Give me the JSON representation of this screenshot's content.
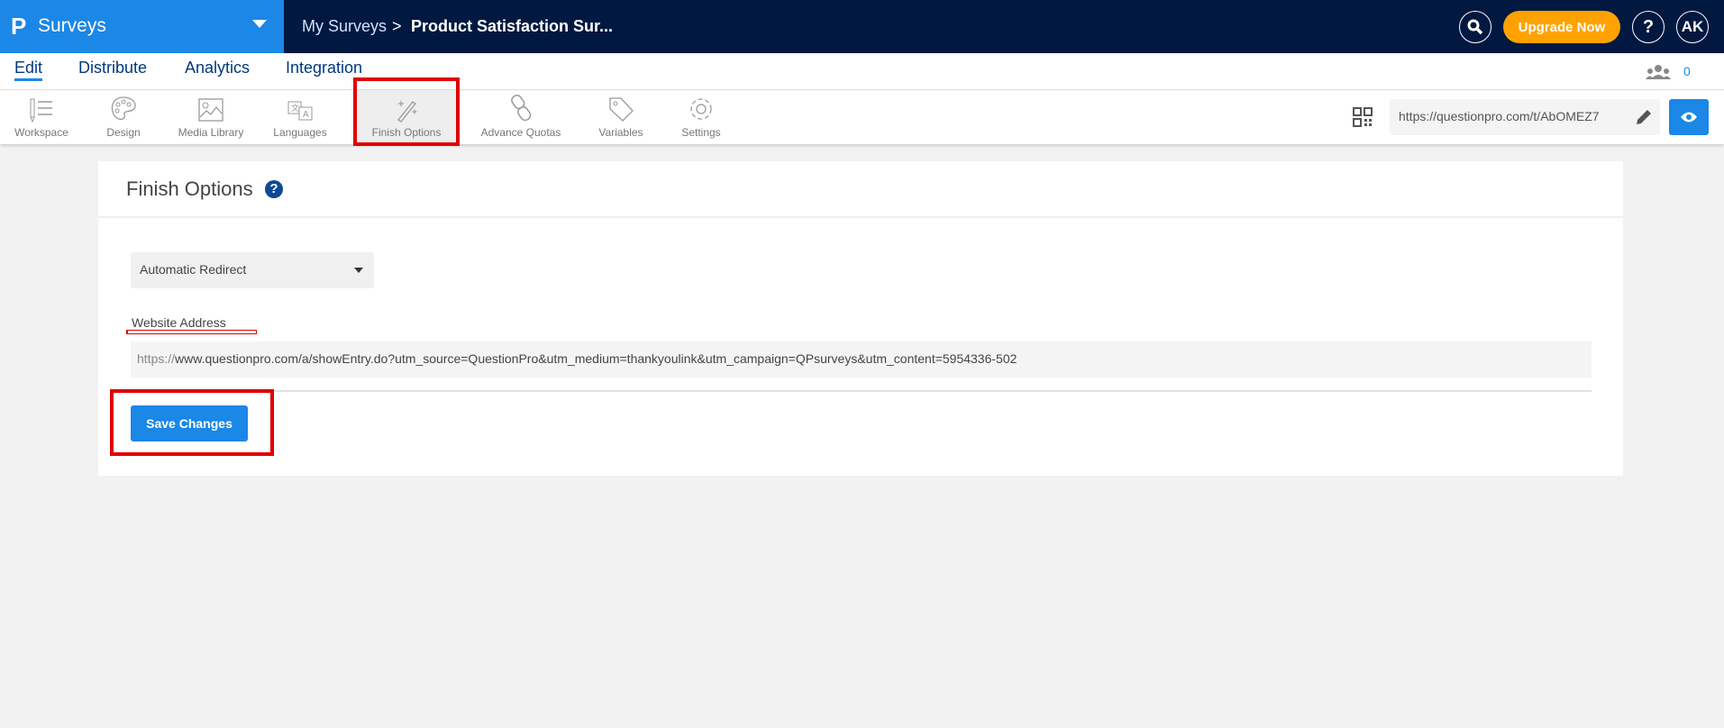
{
  "header": {
    "app_name": "Surveys",
    "breadcrumb_root": "My Surveys",
    "breadcrumb_sep": ">",
    "survey_title": "Product Satisfaction Sur...",
    "upgrade_label": "Upgrade Now",
    "help_label": "?",
    "user_initials": "AK"
  },
  "nav": {
    "tabs": [
      {
        "label": "Edit"
      },
      {
        "label": "Distribute"
      },
      {
        "label": "Analytics"
      },
      {
        "label": "Integration"
      }
    ],
    "collaborators_count": "0"
  },
  "toolbar": {
    "items": [
      {
        "label": "Workspace"
      },
      {
        "label": "Design"
      },
      {
        "label": "Media Library"
      },
      {
        "label": "Languages"
      },
      {
        "label": "Finish Options"
      },
      {
        "label": "Advance Quotas"
      },
      {
        "label": "Variables"
      },
      {
        "label": "Settings"
      }
    ],
    "survey_url": "https://questionpro.com/t/AbOMEZ7"
  },
  "main": {
    "title": "Finish Options",
    "help_icon": "?",
    "finish_type": "Automatic Redirect",
    "website_label": "Website Address",
    "website_prefix": "https://",
    "website_value": "www.questionpro.com/a/showEntry.do?utm_source=QuestionPro&utm_medium=thankyoulink&utm_campaign=QPsurveys&utm_content=5954336-502",
    "save_label": "Save Changes"
  },
  "colors": {
    "brand": "#1b87e6",
    "topbar": "#011840",
    "upgrade": "#ffa200",
    "highlight": "#e00000"
  }
}
